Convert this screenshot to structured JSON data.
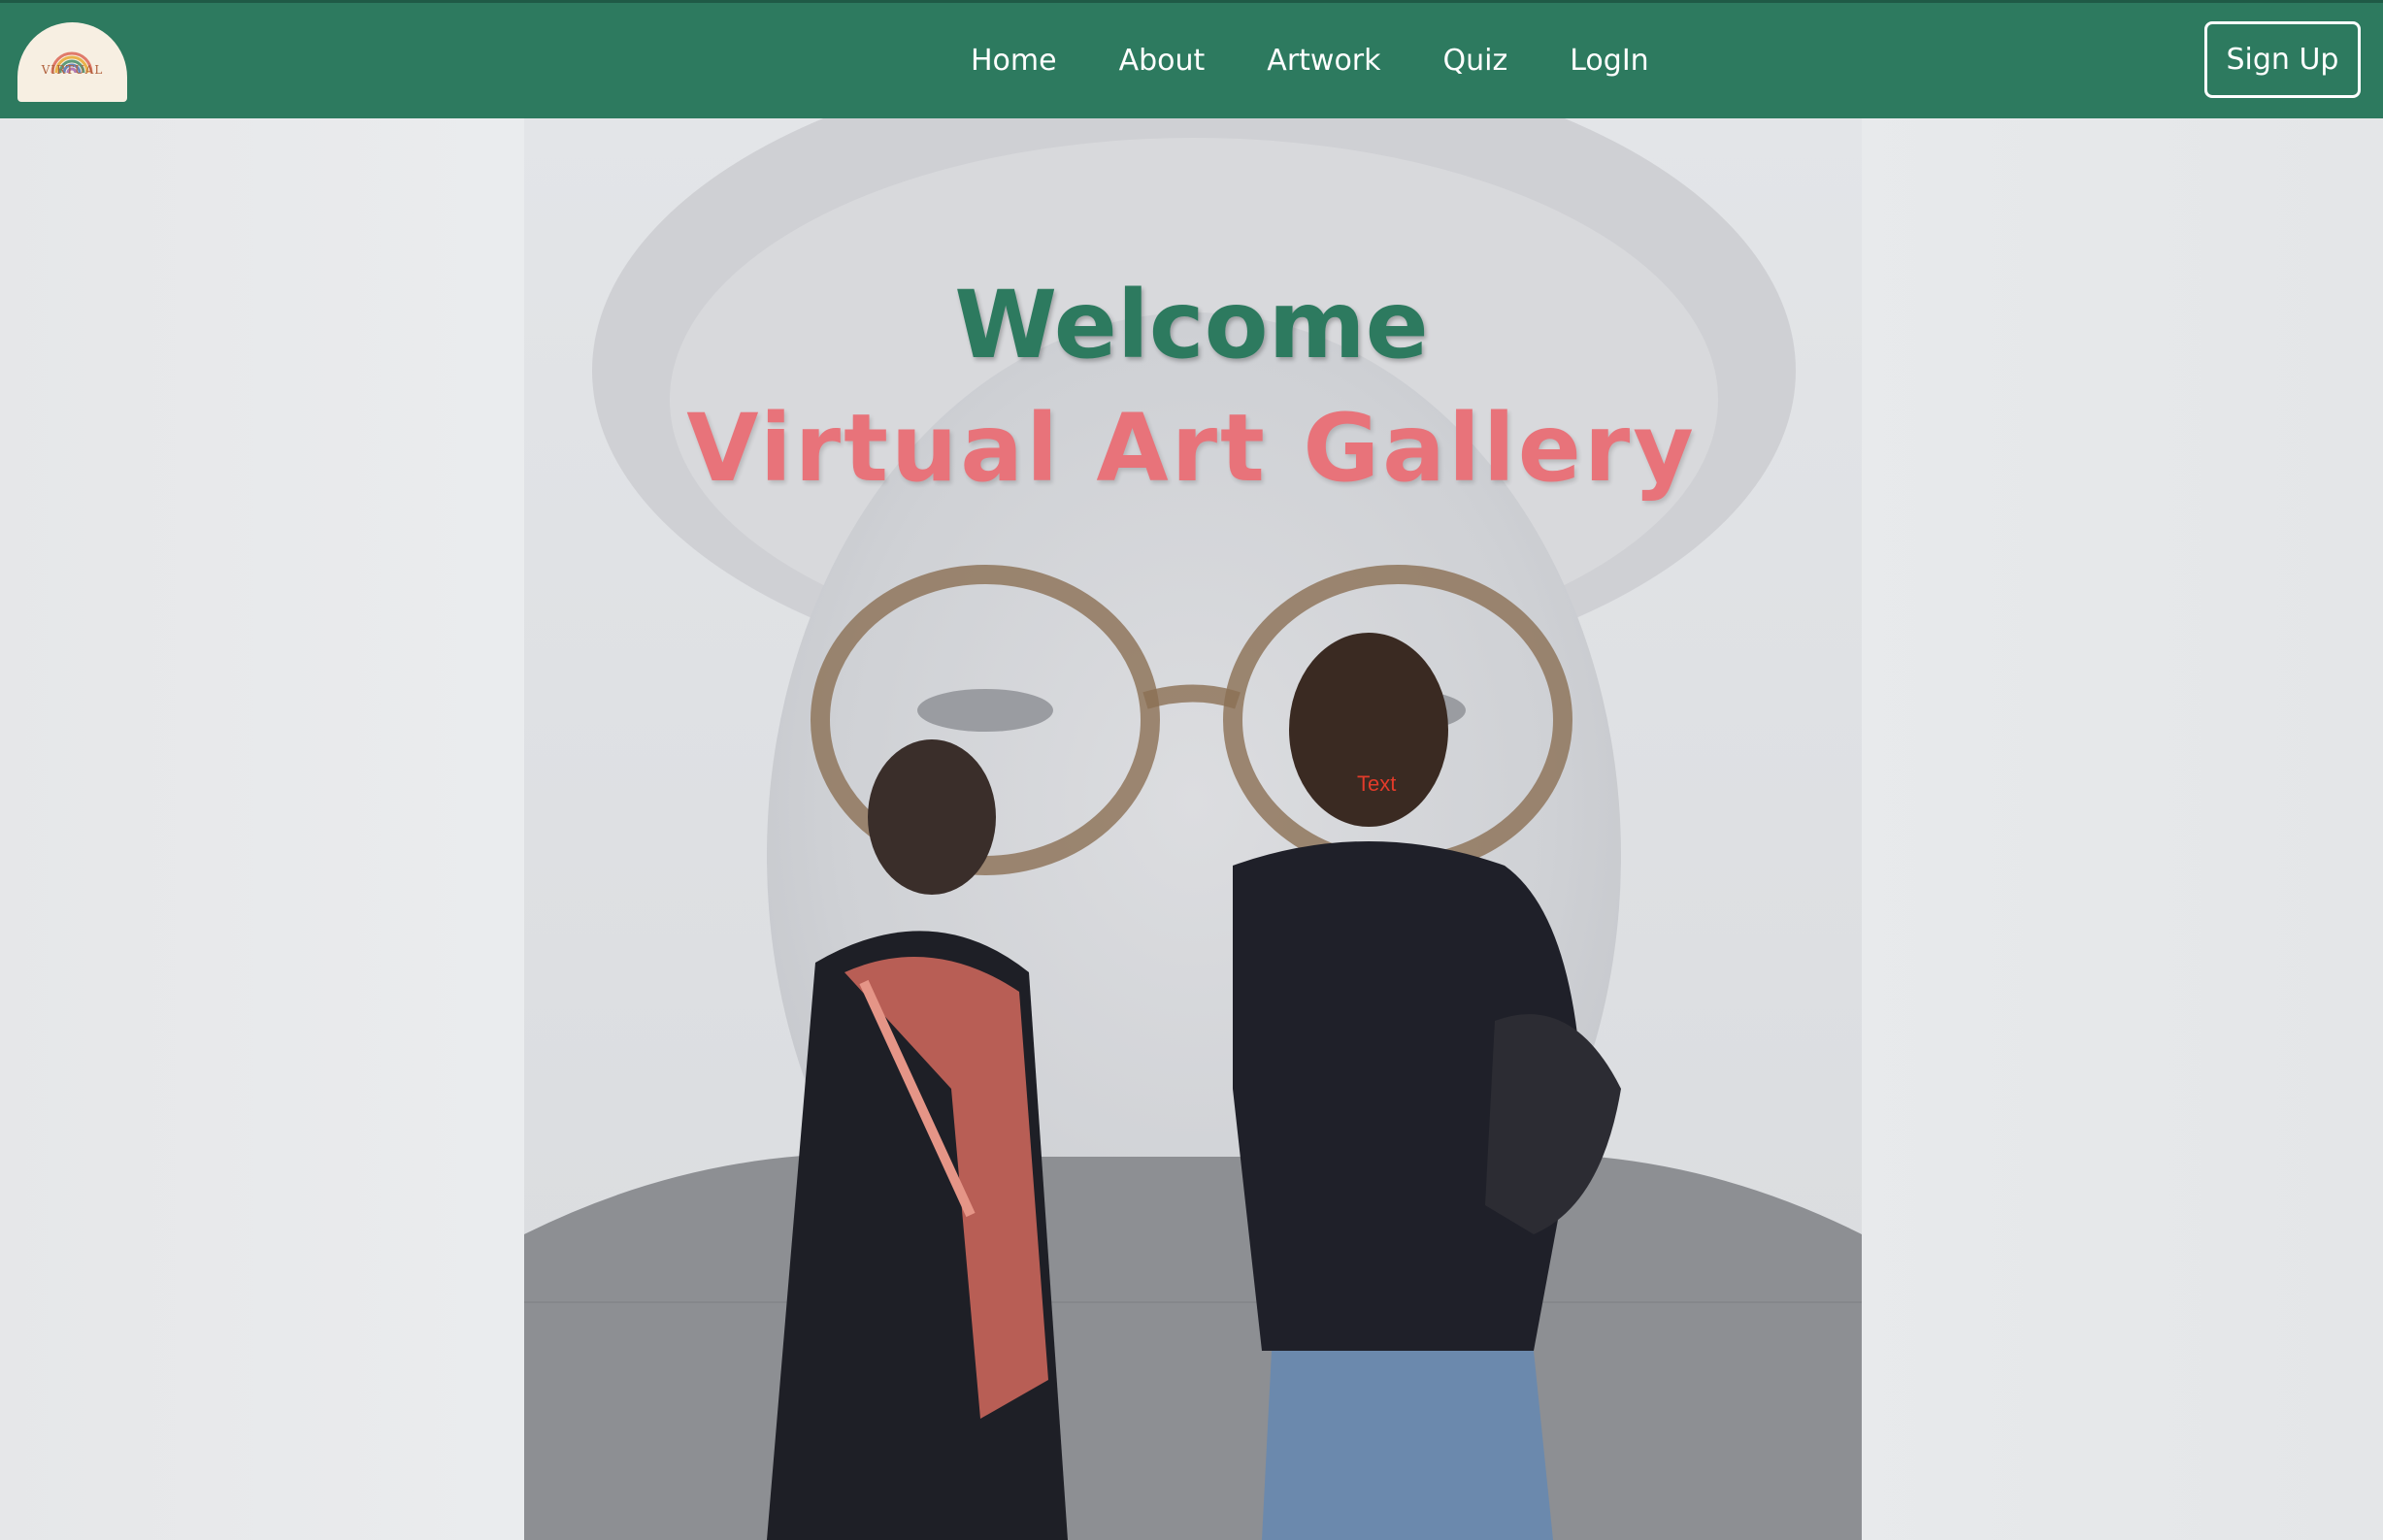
{
  "nav": {
    "logo_text": "VIRTUAL",
    "links": [
      "Home",
      "About",
      "Artwork",
      "Quiz",
      "LogIn"
    ],
    "signup_label": "Sign Up"
  },
  "hero": {
    "welcome": "Welcome",
    "title": "Virtual Art Gallery",
    "placeholder_text": "Text"
  },
  "colors": {
    "nav_bg": "#2d7a5f",
    "welcome": "#2d7a5f",
    "title": "#e8737a",
    "placeholder": "#e23b2a"
  }
}
